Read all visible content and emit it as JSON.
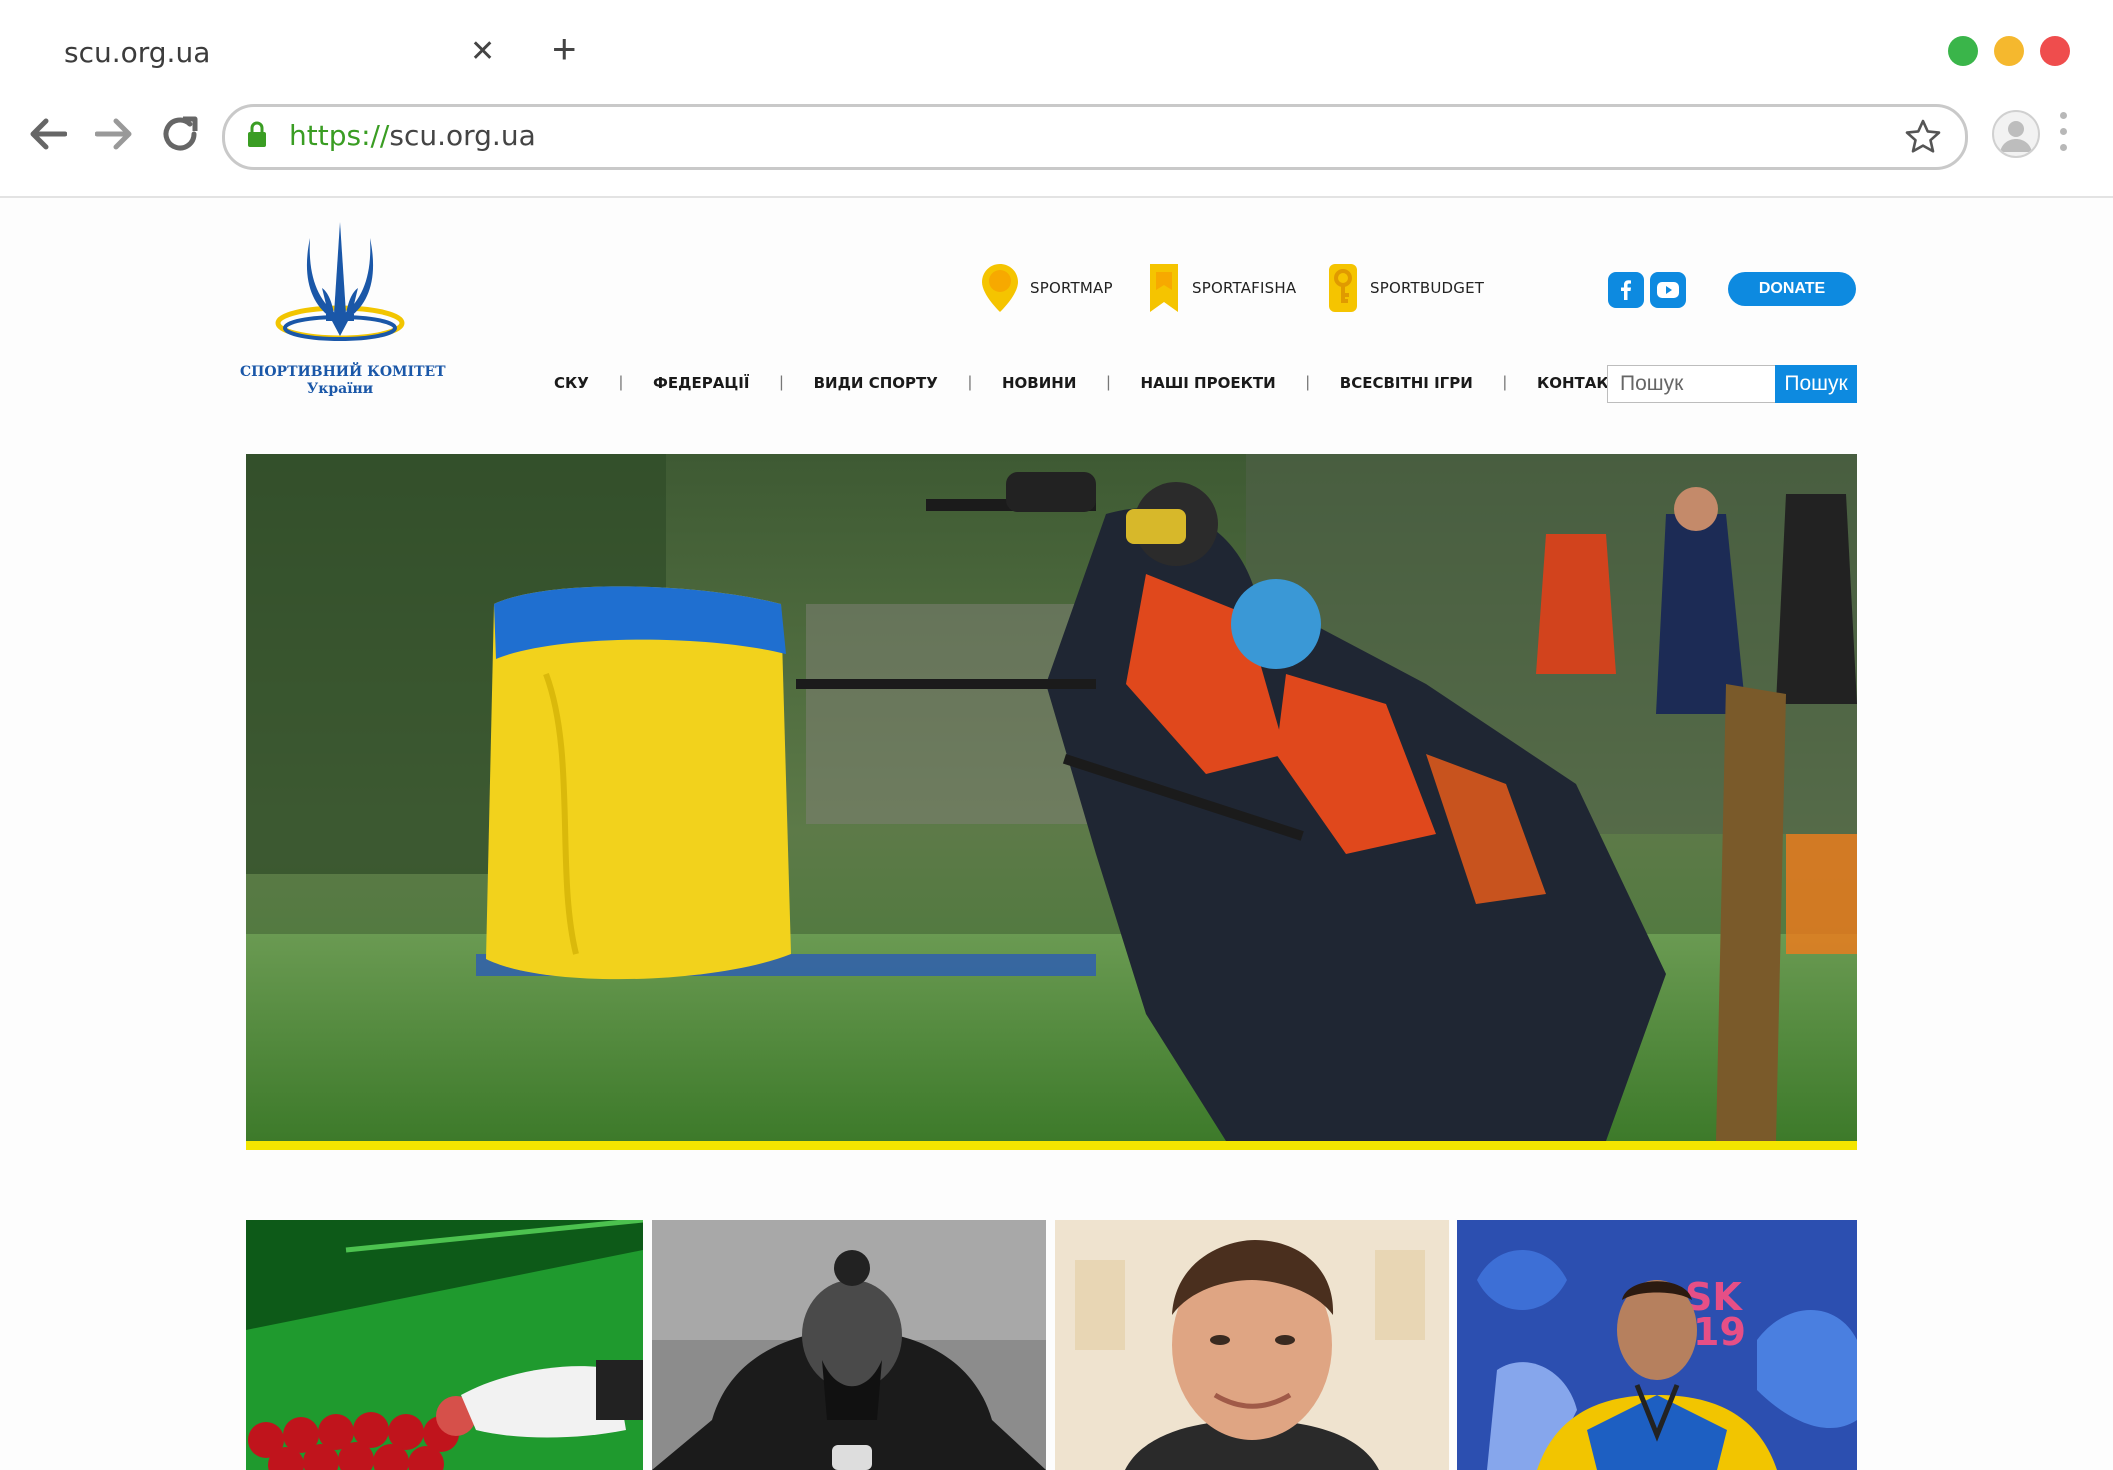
{
  "browser": {
    "tab_title": "scu.org.ua",
    "url_scheme": "https://",
    "url_rest": "scu.org.ua",
    "window_controls": [
      "#3ab54a",
      "#f5b82e",
      "#ef4d4d"
    ]
  },
  "logo": {
    "line1": "СПОРТИВНИЙ КОМІТЕТ",
    "line2": "України",
    "colors": {
      "blue": "#1a57a8",
      "yellow": "#f2c500"
    }
  },
  "projects": [
    {
      "icon": "map-pin-icon",
      "label": "SPORTMAP"
    },
    {
      "icon": "bookmark-icon",
      "label": "SPORTAFISHA"
    },
    {
      "icon": "key-icon",
      "label": "SPORTBUDGET"
    }
  ],
  "social": [
    {
      "icon": "facebook-icon"
    },
    {
      "icon": "youtube-icon"
    }
  ],
  "donate_label": "DONATE",
  "nav": [
    "СКУ",
    "ФЕДЕРАЦІЇ",
    "ВИДИ СПОРТУ",
    "НОВИНИ",
    "НАШІ ПРОЕКТИ",
    "ВСЕСВІТНІ ІГРИ",
    "КОНТАКТИ"
  ],
  "nav_separator": "|",
  "search": {
    "placeholder": "Пошук",
    "button_label": "Пошук"
  },
  "slider": {
    "slide_count": 12,
    "active_index": 3,
    "accent_color": "#f3e500"
  },
  "news_thumbs": [
    "snooker-photo",
    "athlete-mask-photo",
    "official-portrait-photo",
    "boxer-medal-photo"
  ]
}
